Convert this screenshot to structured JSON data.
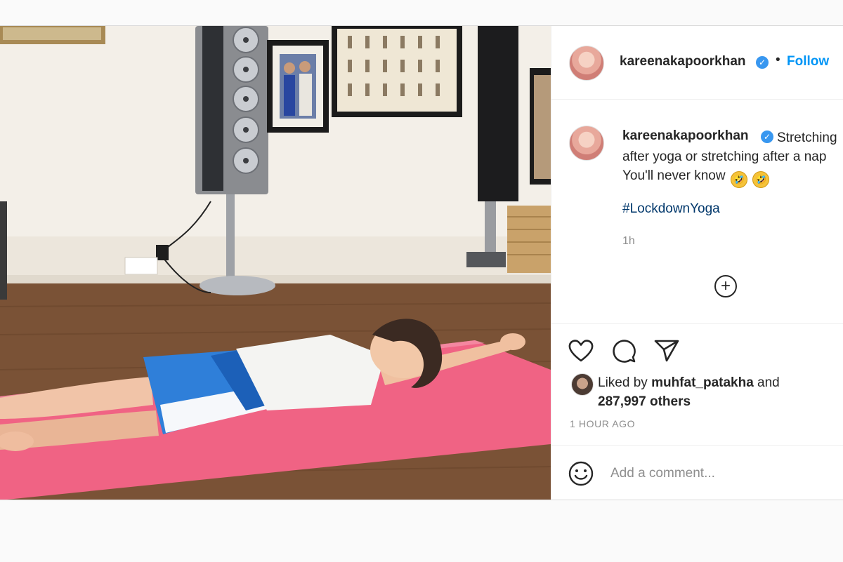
{
  "post": {
    "author": {
      "username": "kareenakapoorkhan",
      "verified_icon": "verified-badge-icon"
    },
    "follow_label": "Follow",
    "separator": "•",
    "caption": {
      "username": "kareenakapoorkhan",
      "line1": "Stretching",
      "line2": "after yoga or stretching after a nap",
      "line3": "You'll never know",
      "emojis": [
        "🤣",
        "🤣"
      ],
      "hashtag": "#LockdownYoga",
      "time": "1h"
    },
    "likes": {
      "prefix": "Liked by",
      "user": "muhfat_patakha",
      "conjunction": "and",
      "others": "287,997 others"
    },
    "time_ago": "1 HOUR AGO",
    "comment": {
      "placeholder": "Add a comment..."
    },
    "icons": {
      "like": "heart-icon",
      "comment": "comment-bubble-icon",
      "share": "paper-plane-icon",
      "more": "plus-circle-icon",
      "emoji": "smiley-icon"
    },
    "colors": {
      "accent": "#0095f6",
      "verified": "#3897f0",
      "hashtag": "#00376b",
      "muted": "#8e8e8e",
      "yoga_mat": "#f06384"
    }
  }
}
